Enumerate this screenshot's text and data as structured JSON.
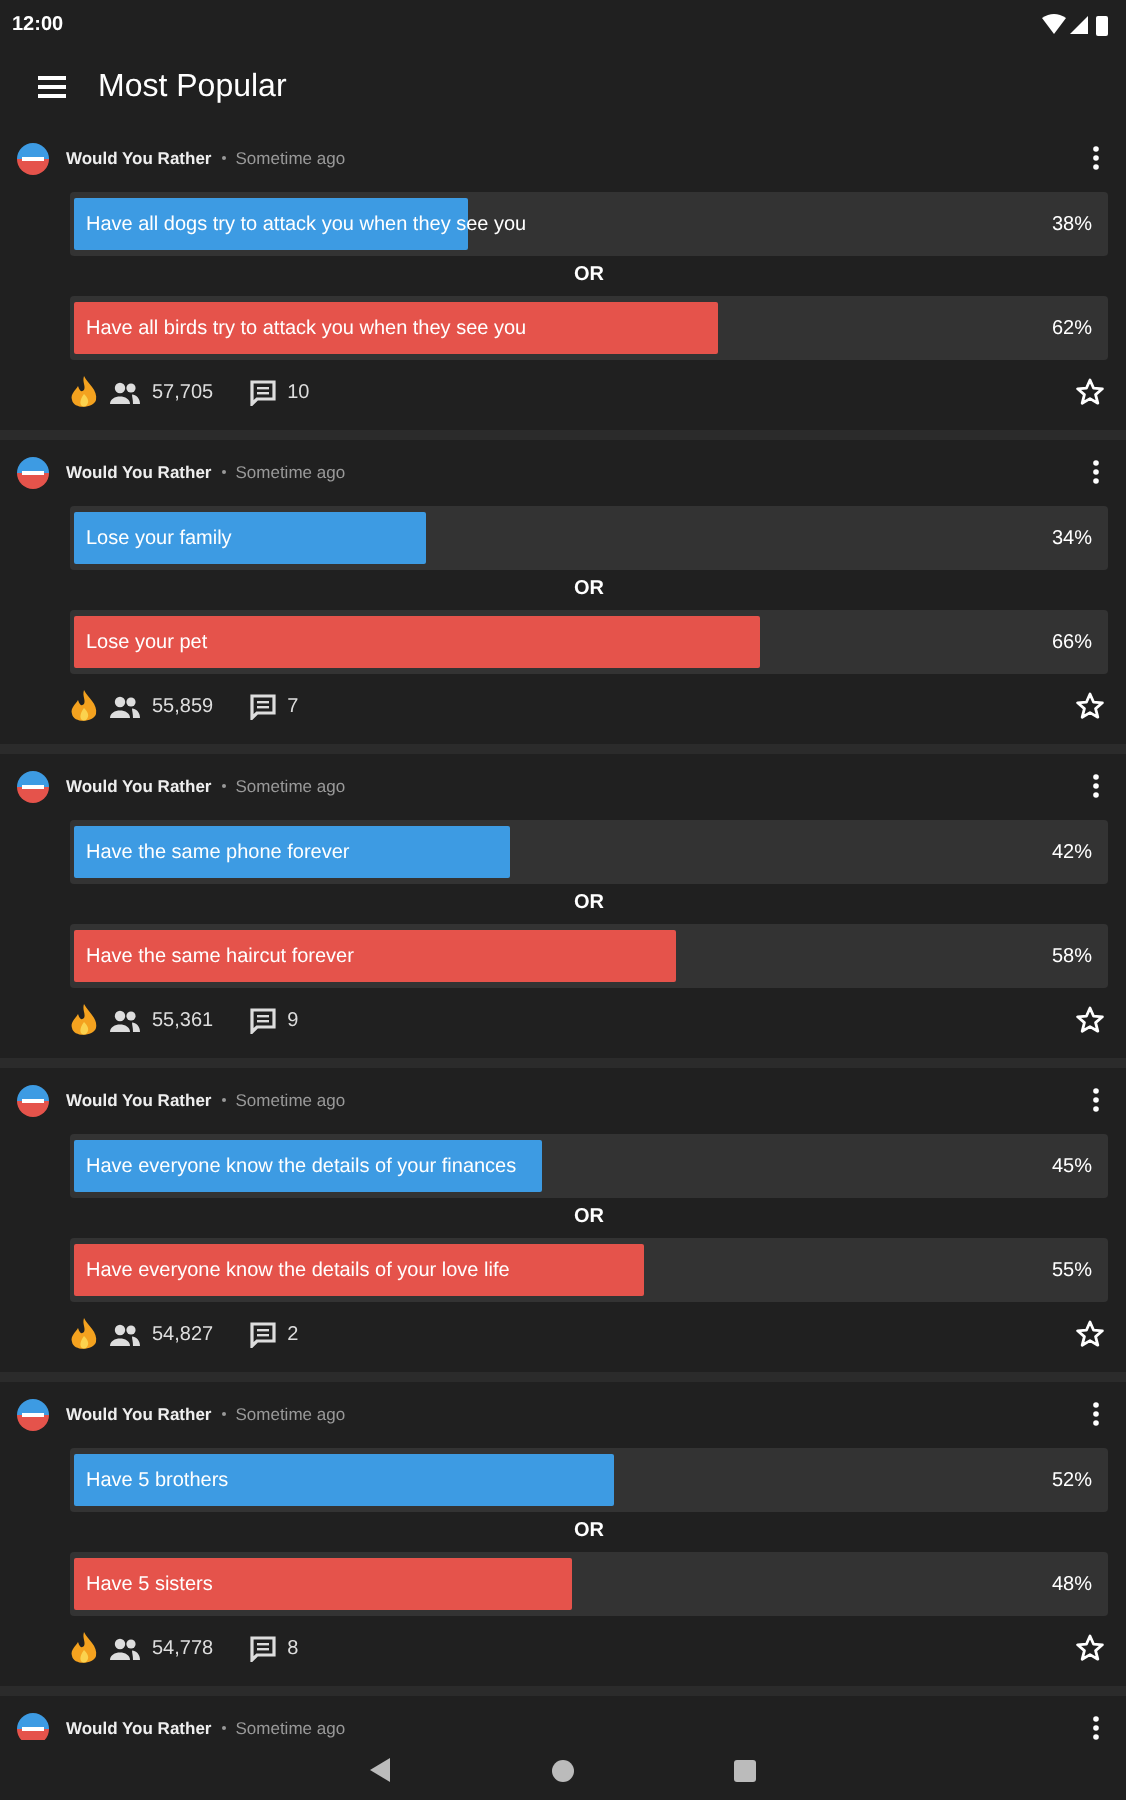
{
  "status_bar": {
    "time": "12:00"
  },
  "app_bar": {
    "title": "Most Popular"
  },
  "polls": [
    {
      "author": "Would You Rather",
      "time": "Sometime ago",
      "separator": "OR",
      "voters": "57,705",
      "comments": "10",
      "favorite": false,
      "options": [
        {
          "text": "Have all dogs try to attack you when they see you",
          "level": 0.38,
          "percent": "38%",
          "color": "#3d9be3"
        },
        {
          "text": "Have all birds try to attack you when they see you",
          "level": 0.62,
          "percent": "62%",
          "color": "#e5534b"
        }
      ]
    },
    {
      "author": "Would You Rather",
      "time": "Sometime ago",
      "separator": "OR",
      "voters": "55,859",
      "comments": "7",
      "favorite": false,
      "options": [
        {
          "text": "Lose your family",
          "level": 0.34,
          "percent": "34%",
          "color": "#3d9be3"
        },
        {
          "text": "Lose your pet",
          "level": 0.66,
          "percent": "66%",
          "color": "#e5534b"
        }
      ]
    },
    {
      "author": "Would You Rather",
      "time": "Sometime ago",
      "separator": "OR",
      "voters": "55,361",
      "comments": "9",
      "favorite": false,
      "options": [
        {
          "text": "Have the same phone forever",
          "level": 0.42,
          "percent": "42%",
          "color": "#3d9be3"
        },
        {
          "text": "Have the same haircut forever",
          "level": 0.58,
          "percent": "58%",
          "color": "#e5534b"
        }
      ]
    },
    {
      "author": "Would You Rather",
      "time": "Sometime ago",
      "separator": "OR",
      "voters": "54,827",
      "comments": "2",
      "favorite": false,
      "options": [
        {
          "text": "Have everyone know the details of your finances",
          "level": 0.45,
          "percent": "45%",
          "color": "#3d9be3"
        },
        {
          "text": "Have everyone know the details of your love life",
          "level": 0.55,
          "percent": "55%",
          "color": "#e5534b"
        }
      ]
    },
    {
      "author": "Would You Rather",
      "time": "Sometime ago",
      "separator": "OR",
      "voters": "54,778",
      "comments": "8",
      "favorite": false,
      "options": [
        {
          "text": "Have 5 brothers",
          "level": 0.52,
          "percent": "52%",
          "color": "#3d9be3"
        },
        {
          "text": "Have 5 sisters",
          "level": 0.48,
          "percent": "48%",
          "color": "#e5534b"
        }
      ]
    },
    {
      "author": "Would You Rather",
      "time": "Sometime ago"
    }
  ]
}
